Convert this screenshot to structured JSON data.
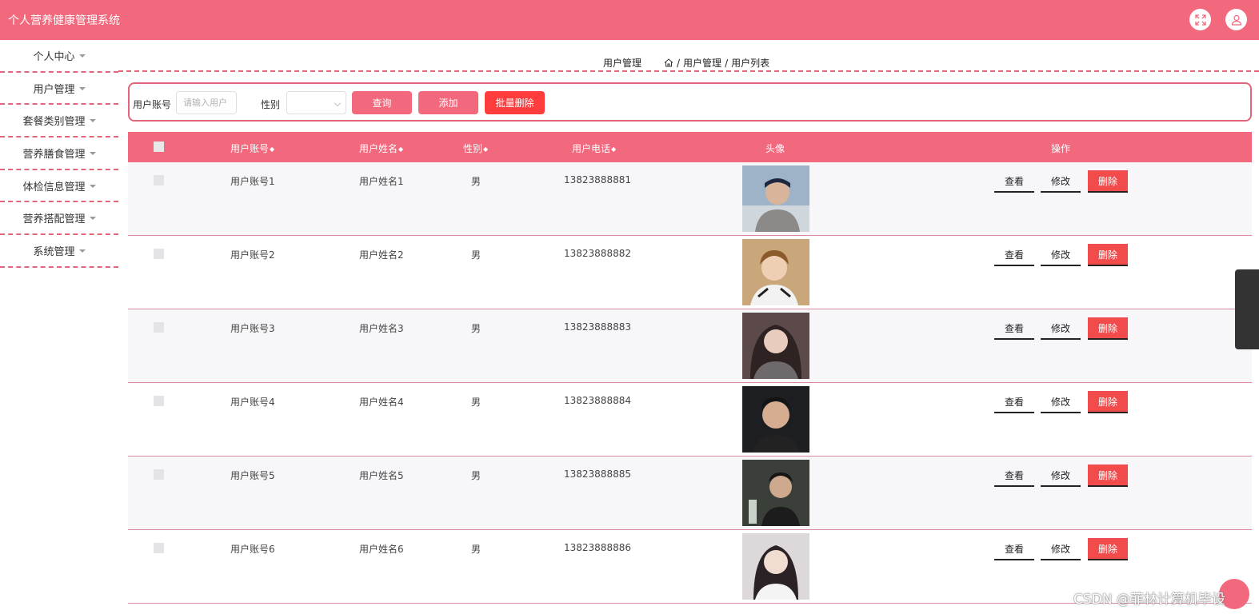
{
  "header": {
    "title": "个人营养健康管理系统",
    "fullscreen_icon": "expand-icon",
    "user_icon": "user-icon"
  },
  "sidebar": {
    "items": [
      {
        "label": "个人中心"
      },
      {
        "label": "用户管理"
      },
      {
        "label": "套餐类别管理"
      },
      {
        "label": "营养膳食管理"
      },
      {
        "label": "体检信息管理"
      },
      {
        "label": "营养搭配管理"
      },
      {
        "label": "系统管理"
      }
    ]
  },
  "breadcrumb": {
    "title": "用户管理",
    "separator": "/",
    "path": [
      "用户管理",
      "用户列表"
    ]
  },
  "search": {
    "account_label": "用户账号",
    "account_placeholder": "请输入用户",
    "gender_label": "性别",
    "gender_value": "",
    "query_button": "查询",
    "add_button": "添加",
    "bulk_delete_button": "批量删除"
  },
  "table": {
    "columns": [
      "用户账号",
      "用户姓名",
      "性别",
      "用户电话",
      "头像",
      "操作"
    ],
    "actions": {
      "view": "查看",
      "edit": "修改",
      "delete": "删除"
    },
    "rows": [
      {
        "account": "用户账号1",
        "name": "用户姓名1",
        "gender": "男",
        "phone": "13823888881"
      },
      {
        "account": "用户账号2",
        "name": "用户姓名2",
        "gender": "男",
        "phone": "13823888882"
      },
      {
        "account": "用户账号3",
        "name": "用户姓名3",
        "gender": "男",
        "phone": "13823888883"
      },
      {
        "account": "用户账号4",
        "name": "用户姓名4",
        "gender": "男",
        "phone": "13823888884"
      },
      {
        "account": "用户账号5",
        "name": "用户姓名5",
        "gender": "男",
        "phone": "13823888885"
      },
      {
        "account": "用户账号6",
        "name": "用户姓名6",
        "gender": "男",
        "phone": "13823888886"
      }
    ]
  },
  "watermark": "CSDN @菲林计算机毕设",
  "colors": {
    "primary": "#f2687d",
    "danger": "#f24b4b",
    "dashed_border": "#e2657a"
  }
}
